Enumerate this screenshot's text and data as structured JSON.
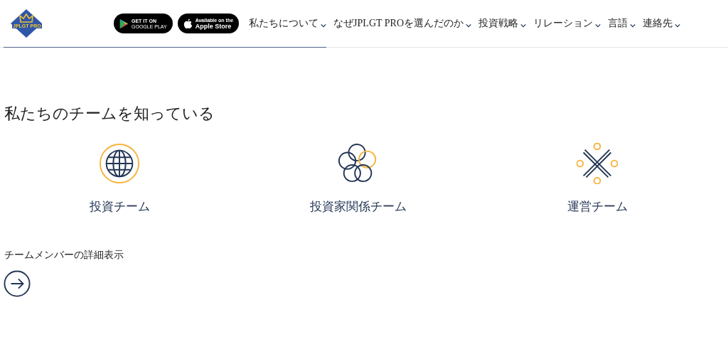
{
  "header": {
    "logo": "JPLGT PRO",
    "store_buttons": [
      {
        "kind": "google",
        "line1": "GET IT ON",
        "line2": "GOOGLE PLAY"
      },
      {
        "kind": "apple",
        "line1": "Available on the",
        "line2": "Apple Store"
      }
    ],
    "nav": [
      "私たちについて",
      "なぜJPLGT PROを選んだのか",
      "投資戦略",
      "リレーション",
      "言語",
      "連絡先"
    ]
  },
  "heading": "私たちのチームを知っている",
  "teams": [
    {
      "kind": "globe",
      "label": "投資チーム"
    },
    {
      "kind": "circles",
      "label": "投資家関係チーム"
    },
    {
      "kind": "cross",
      "label": "運営チーム"
    }
  ],
  "more": {
    "label": "チームメンバーの詳細表示"
  }
}
